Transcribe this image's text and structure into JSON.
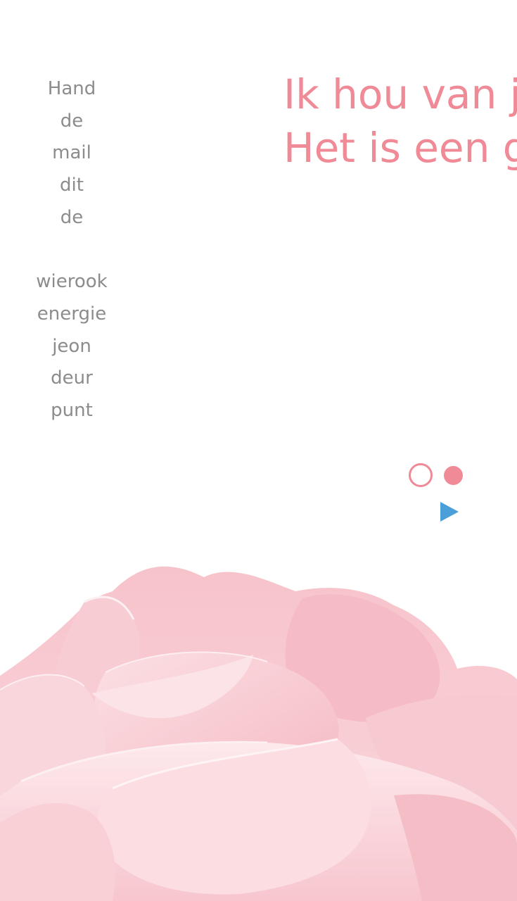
{
  "nav": {
    "items": [
      {
        "label": "Hand"
      },
      {
        "label": "de"
      },
      {
        "label": "mail"
      },
      {
        "label": "dit"
      },
      {
        "label": "de"
      },
      {
        "label": ""
      },
      {
        "label": "wierook"
      },
      {
        "label": "energie"
      },
      {
        "label": "jeon"
      },
      {
        "label": "deur"
      },
      {
        "label": "punt"
      }
    ]
  },
  "headline": {
    "line1": "Ik hou van jo",
    "line2": "Het is een ge"
  },
  "carousel": {
    "slide_count": 2,
    "active_index": 1,
    "play_icon": "play-icon"
  },
  "colors": {
    "accent_pink": "#ef8a96",
    "nav_gray": "#8c8c8c",
    "play_blue": "#4a9fd8",
    "rose_light": "#f9d3d8",
    "rose_mid": "#f4b7c0"
  },
  "image": {
    "subject": "pink rose"
  }
}
